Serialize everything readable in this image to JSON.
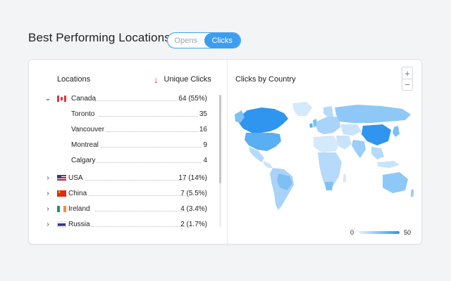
{
  "header": {
    "title": "Best Performing Locations",
    "toggle": [
      {
        "label": "Opens",
        "active": false
      },
      {
        "label": "Clicks",
        "active": true
      }
    ]
  },
  "table": {
    "col_locations": "Locations",
    "col_unique": "Unique Clicks",
    "sort_icon": "arrow-down-icon",
    "rows": [
      {
        "type": "country",
        "expanded": true,
        "flag": "ca",
        "name": "Canada",
        "value": "64 (55%)"
      },
      {
        "type": "city",
        "name": "Toronto",
        "value": "35"
      },
      {
        "type": "city",
        "name": "Vancouver",
        "value": "16"
      },
      {
        "type": "city",
        "name": "Montreal",
        "value": "9"
      },
      {
        "type": "city",
        "name": "Calgary",
        "value": "4"
      },
      {
        "type": "country",
        "expanded": false,
        "flag": "us",
        "name": "USA",
        "value": "17 (14%)"
      },
      {
        "type": "country",
        "expanded": false,
        "flag": "cn",
        "name": "China",
        "value": "7 (5.5%)"
      },
      {
        "type": "country",
        "expanded": false,
        "flag": "ie",
        "name": "Ireland",
        "value": "4 (3.4%)"
      },
      {
        "type": "country",
        "expanded": false,
        "flag": "ru",
        "name": "Russia",
        "value": "2 (1.7%)"
      }
    ]
  },
  "map": {
    "title": "Clicks by Country",
    "zoom_in": "+",
    "zoom_out": "−",
    "legend_min": "0",
    "legend_max": "50"
  },
  "colors": {
    "accent": "#3d9ef0",
    "sort_arrow": "#e0363f",
    "map_low": "#e6f2fd",
    "map_high": "#2f95ee"
  }
}
